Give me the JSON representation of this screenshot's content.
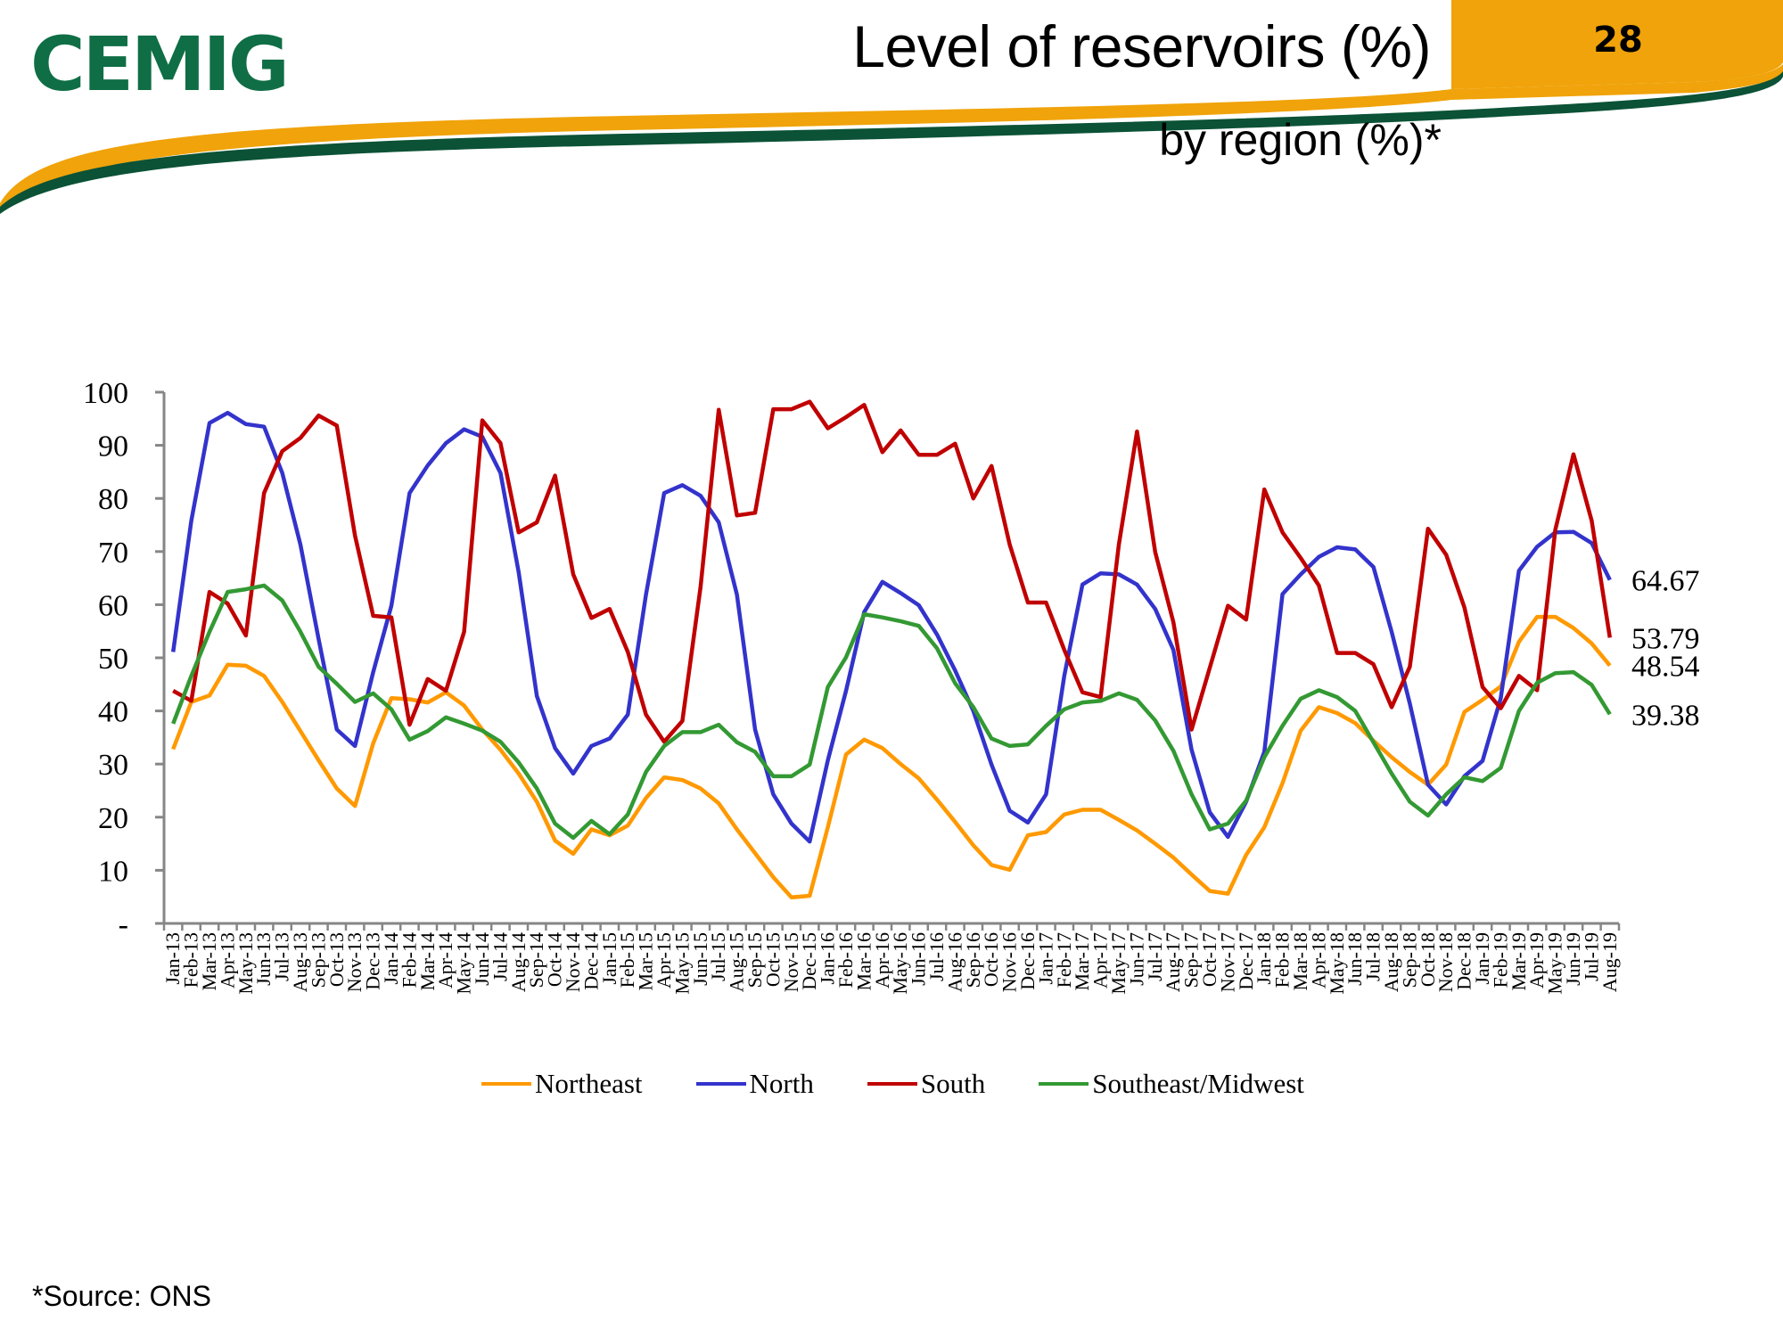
{
  "header": {
    "logo_text": "CEMIG",
    "title": "Level of reservoirs (%)",
    "subtitle": "by region (%)*",
    "page_number": "28",
    "colors": {
      "brand_green": "#0f6e45",
      "brand_orange": "#f0a30a",
      "stripe_green": "#0b5236"
    }
  },
  "footer": {
    "source": "*Source: ONS"
  },
  "chart_data": {
    "type": "line",
    "title": "Level of reservoirs (%) by region (%)*",
    "xlabel": "",
    "ylabel": "",
    "ylim": [
      0,
      100
    ],
    "yticks": [
      0,
      10,
      20,
      30,
      40,
      50,
      60,
      70,
      80,
      90,
      100
    ],
    "ytick_labels": [
      "-",
      "10",
      "20",
      "30",
      "40",
      "50",
      "60",
      "70",
      "80",
      "90",
      "100"
    ],
    "grid": false,
    "legend_position": "bottom",
    "x": [
      "Jan-13",
      "Feb-13",
      "Mar-13",
      "Apr-13",
      "May-13",
      "Jun-13",
      "Jul-13",
      "Aug-13",
      "Sep-13",
      "Oct-13",
      "Nov-13",
      "Dec-13",
      "Jan-14",
      "Feb-14",
      "Mar-14",
      "Apr-14",
      "May-14",
      "Jun-14",
      "Jul-14",
      "Aug-14",
      "Sep-14",
      "Oct-14",
      "Nov-14",
      "Dec-14",
      "Jan-15",
      "Feb-15",
      "Mar-15",
      "Apr-15",
      "May-15",
      "Jun-15",
      "Jul-15",
      "Aug-15",
      "Sep-15",
      "Oct-15",
      "Nov-15",
      "Dec-15",
      "Jan-16",
      "Feb-16",
      "Mar-16",
      "Apr-16",
      "May-16",
      "Jun-16",
      "Jul-16",
      "Aug-16",
      "Sep-16",
      "Oct-16",
      "Nov-16",
      "Dec-16",
      "Jan-17",
      "Feb-17",
      "Mar-17",
      "Apr-17",
      "May-17",
      "Jun-17",
      "Jul-17",
      "Aug-17",
      "Sep-17",
      "Oct-17",
      "Nov-17",
      "Dec-17",
      "Jan-18",
      "Feb-18",
      "Mar-18",
      "Apr-18",
      "May-18",
      "Jun-18",
      "Jul-18",
      "Aug-18",
      "Sep-18",
      "Oct-18",
      "Nov-18",
      "Dec-18",
      "Jan-19",
      "Feb-19",
      "Mar-19",
      "Apr-19",
      "May-19",
      "Jun-19",
      "Jul-19",
      "Aug-19"
    ],
    "series": [
      {
        "name": "Northeast",
        "color": "#ff9900",
        "end_label": "48.54",
        "values": [
          32.8,
          41.7,
          42.9,
          48.7,
          48.5,
          46.6,
          41.7,
          36.2,
          30.7,
          25.4,
          22.1,
          33.9,
          42.4,
          42.2,
          41.6,
          43.5,
          41.0,
          36.5,
          32.7,
          28.2,
          22.9,
          15.6,
          13.1,
          17.7,
          16.6,
          18.4,
          23.6,
          27.5,
          27.0,
          25.4,
          22.6,
          17.7,
          13.2,
          8.7,
          4.9,
          5.2,
          18.1,
          31.8,
          34.6,
          33.0,
          30.0,
          27.3,
          23.3,
          19.1,
          14.7,
          11.0,
          10.1,
          16.6,
          17.2,
          20.5,
          21.4,
          21.4,
          19.5,
          17.5,
          15.0,
          12.4,
          9.2,
          6.1,
          5.6,
          12.9,
          18.1,
          26.4,
          36.3,
          40.7,
          39.6,
          37.7,
          34.4,
          31.3,
          28.5,
          26.1,
          29.9,
          39.8,
          42.1,
          44.6,
          53.0,
          57.7,
          57.7,
          55.6,
          52.7,
          48.54
        ]
      },
      {
        "name": "North",
        "color": "#3333cc",
        "end_label": "64.67",
        "values": [
          51.1,
          75.8,
          94.2,
          96.1,
          94.0,
          93.5,
          84.8,
          71.3,
          53.5,
          36.5,
          33.4,
          47.3,
          59.8,
          81.0,
          86.2,
          90.4,
          93.0,
          91.6,
          84.8,
          66.1,
          42.8,
          33.0,
          28.2,
          33.4,
          34.8,
          39.3,
          61.9,
          81.0,
          82.5,
          80.5,
          75.5,
          61.9,
          36.5,
          24.3,
          18.8,
          15.4,
          30.7,
          43.8,
          58.6,
          64.3,
          62.2,
          59.9,
          54.4,
          47.6,
          40.0,
          29.9,
          21.2,
          19.0,
          24.3,
          46.6,
          63.8,
          65.9,
          65.7,
          63.8,
          59.2,
          51.5,
          32.7,
          20.9,
          16.3,
          22.9,
          32.3,
          62.0,
          65.7,
          69.0,
          70.8,
          70.4,
          67.1,
          54.9,
          41.4,
          26.1,
          22.4,
          27.7,
          30.6,
          42.4,
          66.4,
          70.9,
          73.6,
          73.7,
          71.6,
          64.67
        ]
      },
      {
        "name": "South",
        "color": "#c00000",
        "end_label": "53.79",
        "values": [
          43.8,
          41.9,
          62.4,
          60.2,
          54.2,
          81.0,
          88.9,
          91.4,
          95.6,
          93.7,
          73.0,
          57.9,
          57.6,
          37.4,
          46.0,
          43.8,
          54.9,
          94.7,
          90.4,
          73.6,
          75.5,
          84.3,
          65.7,
          57.5,
          59.2,
          51.1,
          39.3,
          34.2,
          38.1,
          63.3,
          96.7,
          76.8,
          77.3,
          96.8,
          96.8,
          98.2,
          93.2,
          95.3,
          97.6,
          88.7,
          92.8,
          88.2,
          88.2,
          90.3,
          80.0,
          86.1,
          71.3,
          60.4,
          60.4,
          51.5,
          43.5,
          42.6,
          71.3,
          92.6,
          69.9,
          56.7,
          36.5,
          48.1,
          59.8,
          57.2,
          81.7,
          73.6,
          68.8,
          63.6,
          50.9,
          50.9,
          48.8,
          40.7,
          48.3,
          74.3,
          69.4,
          59.5,
          44.5,
          40.5,
          46.6,
          43.9,
          74.1,
          88.3,
          75.8,
          53.79
        ]
      },
      {
        "name": "Southeast/Midwest",
        "color": "#339933",
        "end_label": "39.38",
        "values": [
          37.6,
          46.6,
          54.9,
          62.4,
          62.9,
          63.6,
          60.8,
          54.9,
          48.3,
          45.1,
          41.7,
          43.3,
          40.3,
          34.6,
          36.2,
          38.8,
          37.6,
          36.3,
          34.2,
          30.3,
          25.4,
          18.8,
          16.1,
          19.3,
          16.8,
          20.5,
          28.5,
          33.4,
          36.0,
          36.0,
          37.4,
          34.1,
          32.3,
          27.7,
          27.7,
          29.9,
          44.5,
          50.1,
          58.2,
          57.6,
          56.9,
          56.0,
          51.8,
          45.2,
          40.7,
          34.8,
          33.4,
          33.7,
          37.2,
          40.3,
          41.6,
          41.9,
          43.3,
          42.1,
          38.2,
          32.5,
          24.3,
          17.7,
          18.8,
          23.1,
          31.3,
          37.2,
          42.3,
          43.9,
          42.6,
          40.0,
          34.1,
          28.2,
          22.9,
          20.3,
          24.3,
          27.5,
          26.8,
          29.3,
          40.0,
          45.3,
          47.1,
          47.3,
          44.9,
          39.38
        ]
      }
    ]
  }
}
